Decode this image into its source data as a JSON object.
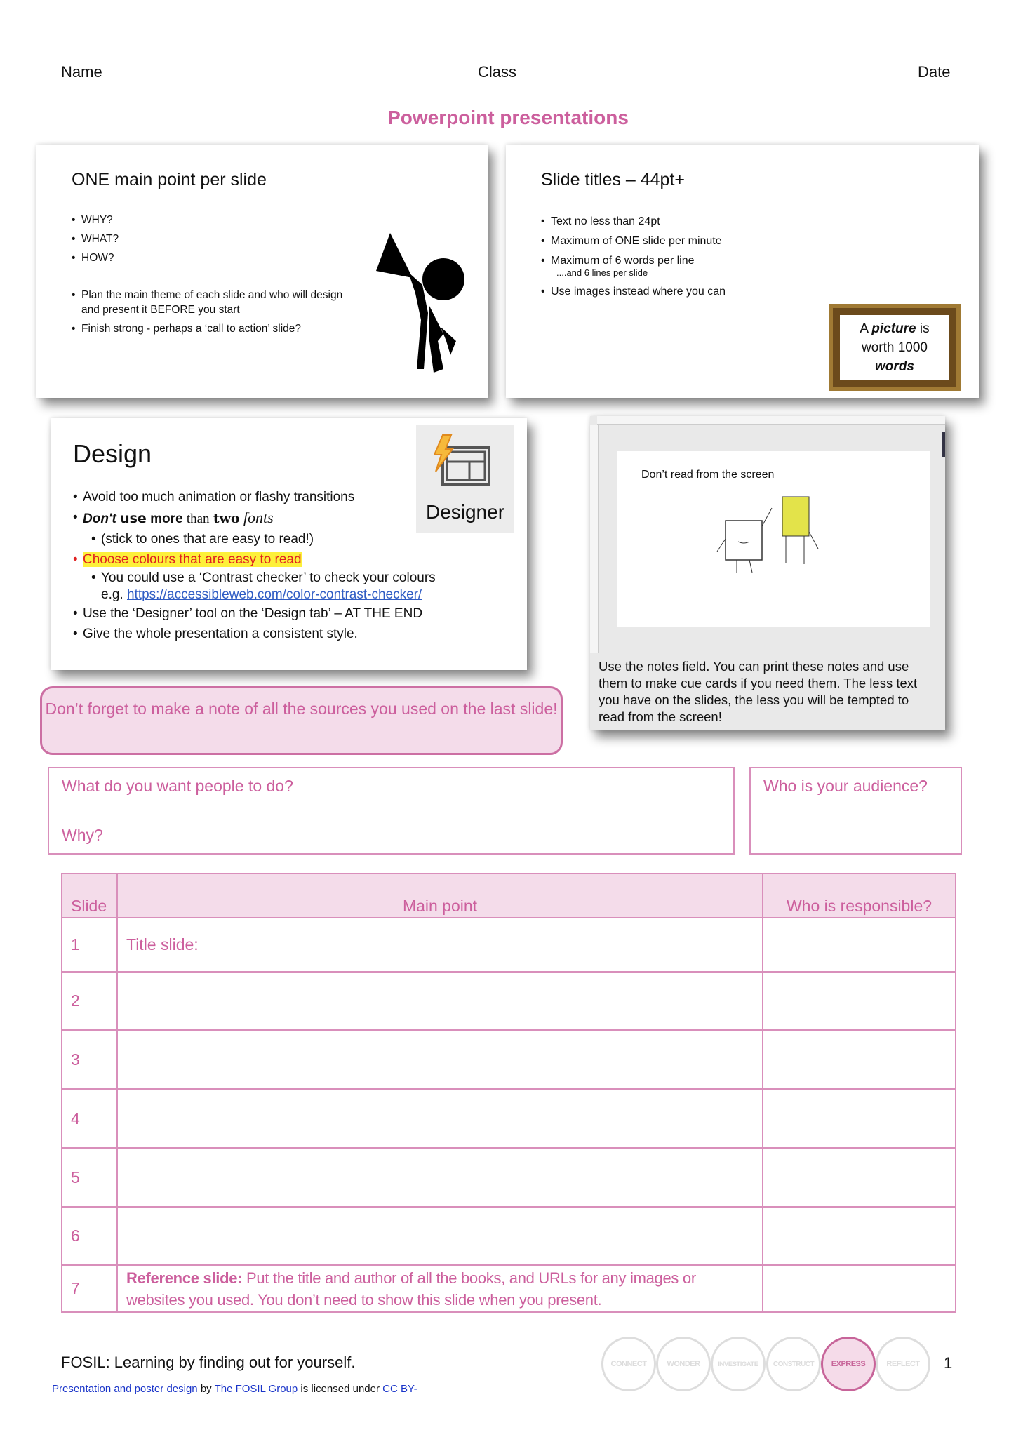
{
  "header": {
    "name": "Name",
    "class": "Class",
    "date": "Date",
    "title": "Powerpoint presentations"
  },
  "slide1": {
    "title": "ONE main point per slide",
    "bullets": [
      "WHY?",
      "WHAT?",
      "HOW?"
    ],
    "bullets2": [
      "Plan the main theme of each slide and who will design and present it BEFORE you start",
      "Finish strong - perhaps a ‘call to action’ slide?"
    ]
  },
  "slide2": {
    "title": "Slide titles – 44pt+",
    "bullets": [
      "Text no less than 24pt",
      "Maximum of ONE slide per minute",
      "Maximum of 6 words per line"
    ],
    "sub": "....and 6 lines per slide",
    "last": "Use images instead where you can",
    "frame": {
      "a": "A",
      "picture": "picture",
      "is": "is",
      "worth": "worth 1000",
      "words": "words"
    }
  },
  "slide3": {
    "title": "Design",
    "designer": "Designer",
    "b1": "Avoid too much animation or flashy transitions",
    "b2": {
      "dont": "Don't",
      "use": "use",
      "more": "more",
      "than": "than",
      "two": "two",
      "fonts": "fonts"
    },
    "b2sub": "(stick to ones that are easy to read!)",
    "b3": "Choose colours that are easy to read",
    "b3sub": "You could use a ‘Contrast checker’ to check your colours",
    "eg": "e.g.",
    "link": "https://accessibleweb.com/color-contrast-checker/",
    "b4": "Use the ‘Designer’ tool on the ‘Design tab’ – AT THE END",
    "b5": "Give the whole presentation a consistent style."
  },
  "notes": {
    "slide_title": "Don’t read from the screen",
    "text": "Use the notes field. You can print these notes and use them to make cue cards if you need them. The less text you have on the slides, the less you will be tempted to read from the screen!"
  },
  "callout": "Don’t forget to make a note of all the sources you used on the last slide!",
  "boxes": {
    "what": "What do you want people to do?",
    "why": "Why?",
    "audience": "Who is your audience?"
  },
  "table": {
    "headers": [
      "Slide",
      "Main point",
      "Who is responsible?"
    ],
    "rows": [
      {
        "n": "1",
        "point": "Title slide:"
      },
      {
        "n": "2",
        "point": ""
      },
      {
        "n": "3",
        "point": ""
      },
      {
        "n": "4",
        "point": ""
      },
      {
        "n": "5",
        "point": ""
      },
      {
        "n": "6",
        "point": ""
      },
      {
        "n": "7",
        "bold": "Reference slide:",
        "point": " Put the title and author of all the books, and URLs for any images or websites you used. You don’t need to show this slide when you present."
      }
    ]
  },
  "footer": {
    "tagline": "FOSIL: Learning by finding out for yourself.",
    "license": {
      "work": "Presentation and poster design",
      "by": " by ",
      "author": "The FOSIL Group",
      "is": " is licensed under ",
      "cc": "CC BY-"
    },
    "stages": [
      "CONNECT",
      "WONDER",
      "INVESTIGATE",
      "CONSTRUCT",
      "EXPRESS",
      "REFLECT"
    ],
    "active_stage": "EXPRESS",
    "page": "1"
  },
  "colors": {
    "accent": "#cc5f9d",
    "fill": "#f4dcea",
    "link": "#1a35c9"
  }
}
